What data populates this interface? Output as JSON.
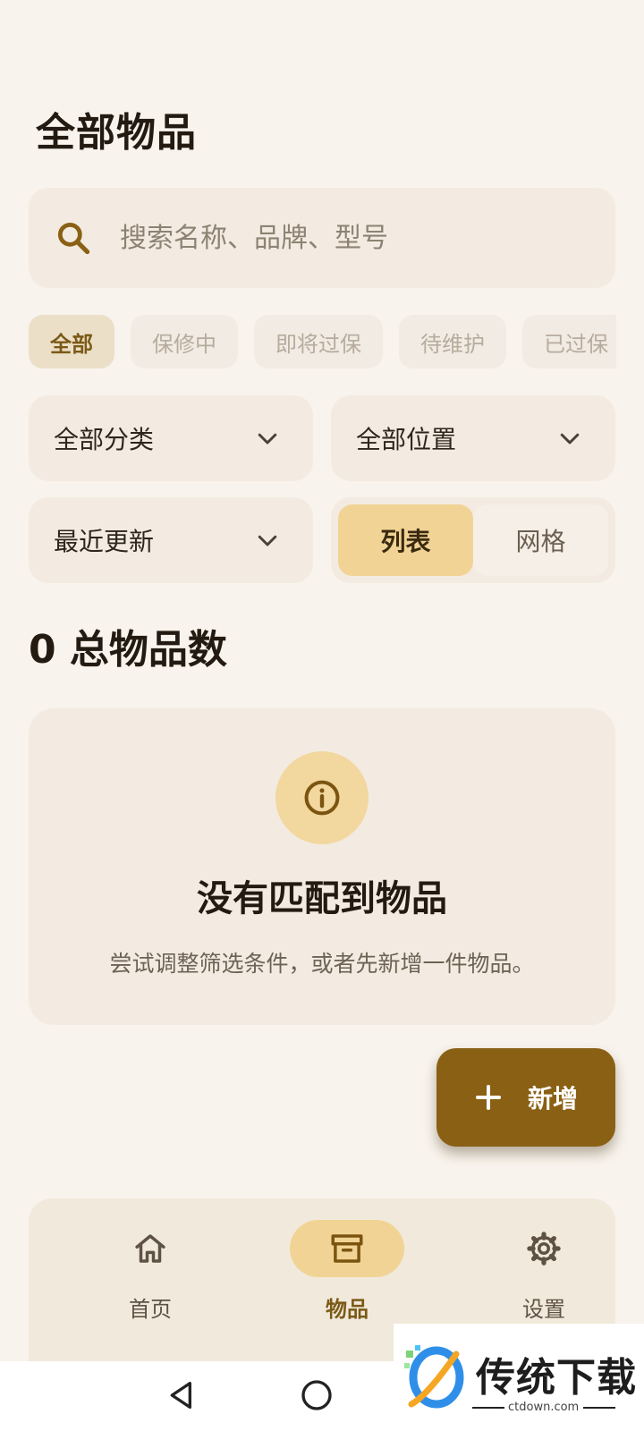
{
  "header": {
    "title": "全部物品"
  },
  "search": {
    "placeholder": "搜索名称、品牌、型号",
    "value": ""
  },
  "status_filters": [
    {
      "label": "全部",
      "active": true
    },
    {
      "label": "保修中",
      "active": false
    },
    {
      "label": "即将过保",
      "active": false
    },
    {
      "label": "待维护",
      "active": false
    },
    {
      "label": "已过保",
      "active": false
    }
  ],
  "filters": {
    "category": "全部分类",
    "location": "全部位置",
    "sort": "最近更新"
  },
  "view_toggle": {
    "list": "列表",
    "grid": "网格",
    "selected": "list"
  },
  "summary": {
    "count_text": "0 总物品数"
  },
  "empty_state": {
    "title": "没有匹配到物品",
    "description": "尝试调整筛选条件，或者先新增一件物品。"
  },
  "fab": {
    "label": "新增"
  },
  "bottom_nav": {
    "items": [
      {
        "label": "首页",
        "icon": "home-icon",
        "active": false
      },
      {
        "label": "物品",
        "icon": "archive-box-icon",
        "active": true
      },
      {
        "label": "设置",
        "icon": "gear-icon",
        "active": false
      }
    ]
  },
  "watermark": {
    "brand": "传统下载",
    "site": "ctdown.com"
  },
  "colors": {
    "background": "#f8f3ec",
    "accent": "#8a6014",
    "accent_light": "#f1d495",
    "surface": "#f3ebe1"
  }
}
